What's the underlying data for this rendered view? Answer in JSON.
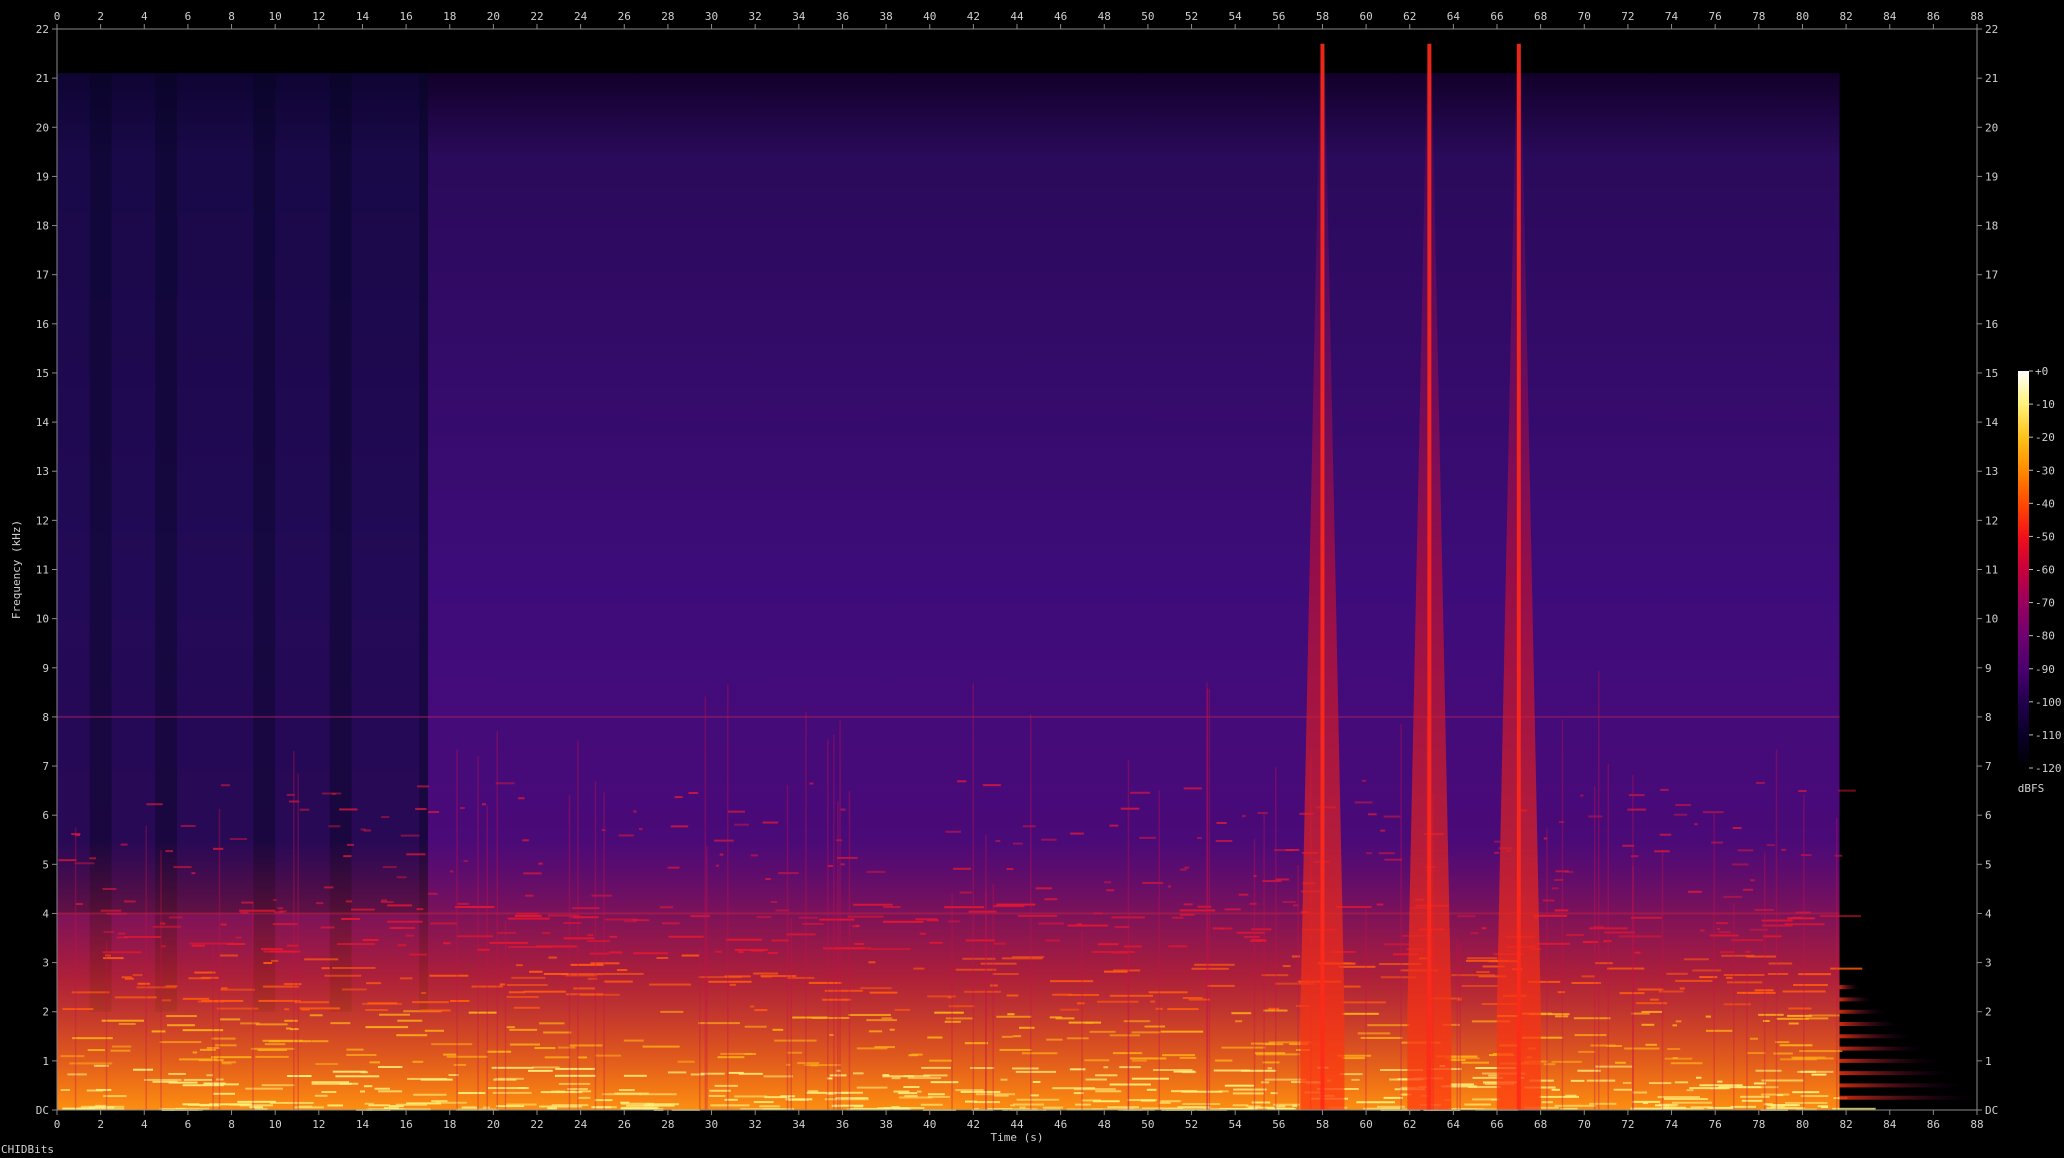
{
  "source_label": "CHIDBits",
  "chart_data": {
    "type": "heatmap",
    "title": "",
    "xlabel": "Time (s)",
    "ylabel": "Frequency (kHz)",
    "xlim": [
      0,
      88
    ],
    "ylim": [
      0,
      22
    ],
    "x_ticks": [
      0,
      2,
      4,
      6,
      8,
      10,
      12,
      14,
      16,
      18,
      20,
      22,
      24,
      26,
      28,
      30,
      32,
      34,
      36,
      38,
      40,
      42,
      44,
      46,
      48,
      50,
      52,
      54,
      56,
      58,
      60,
      62,
      64,
      66,
      68,
      70,
      72,
      74,
      76,
      78,
      80,
      82,
      84,
      86,
      88
    ],
    "y_ticks": [
      "DC",
      "1",
      "2",
      "3",
      "4",
      "5",
      "6",
      "7",
      "8",
      "9",
      "10",
      "11",
      "12",
      "13",
      "14",
      "15",
      "16",
      "17",
      "18",
      "19",
      "20",
      "21",
      "22"
    ],
    "colorbar": {
      "label": "dBFS",
      "ticks": [
        "+0",
        "-10",
        "-20",
        "-30",
        "-40",
        "-50",
        "-60",
        "-70",
        "-80",
        "-90",
        "-100",
        "-110",
        "-120"
      ],
      "colors": [
        "#ffffff",
        "#fff27a",
        "#ffc21a",
        "#ff8a00",
        "#ff4a00",
        "#f2101a",
        "#c8003c",
        "#98005e",
        "#700070",
        "#4a0070",
        "#22004e",
        "#0a0028",
        "#000000"
      ]
    },
    "grid": false,
    "signal_end_s": 81.7,
    "low_noise_interval_s": [
      0,
      17
    ],
    "broadband_transients_s": [
      58,
      62.9,
      67
    ],
    "harmonic_tail_end_s": 88,
    "strong_energy_band_khz": [
      0,
      2
    ]
  }
}
